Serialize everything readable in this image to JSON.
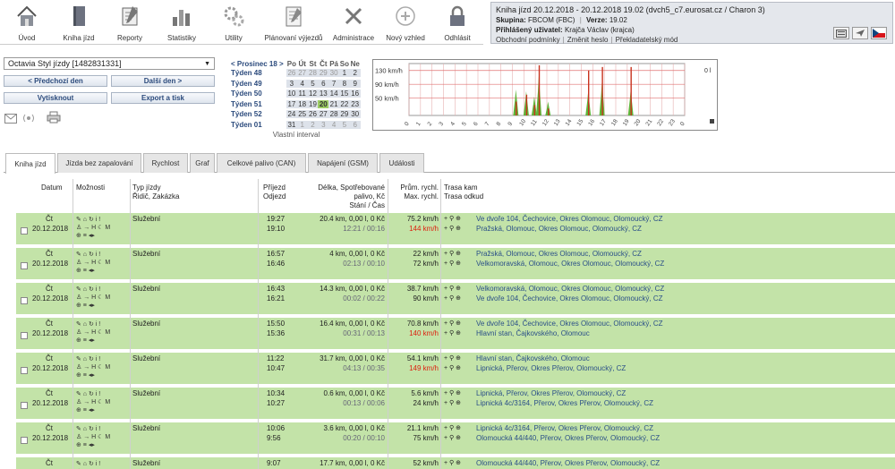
{
  "toolbar": {
    "items": [
      {
        "label": "Úvod",
        "icon": "home-icon"
      },
      {
        "label": "Kniha jízd",
        "icon": "book-icon"
      },
      {
        "label": "Reporty",
        "icon": "report-icon"
      },
      {
        "label": "Statistiky",
        "icon": "statistics-icon"
      },
      {
        "label": "Utility",
        "icon": "gears-icon"
      },
      {
        "label": "Plánovaní výjezdů",
        "icon": "planning-icon"
      },
      {
        "label": "Administrace",
        "icon": "tools-icon"
      },
      {
        "label": "Nový vzhled",
        "icon": "new-look-icon"
      },
      {
        "label": "Odhlásit",
        "icon": "lock-icon"
      }
    ]
  },
  "info": {
    "line1": "Kniha jízd 20.12.2018 - 20.12.2018 19.02 (dvch5_c7.eurosat.cz / Charon 3)",
    "skupina_label": "Skupina:",
    "skupina_value": "FBCOM (FBC)",
    "verze_label": "Verze:",
    "verze_value": "19.02",
    "user_label": "Přihlášený uživatel:",
    "user_value": "Krajča Václav (krajca)",
    "links": [
      "Obchodní podmínky",
      "Změnit heslo",
      "Překladatelský mód"
    ]
  },
  "controls": {
    "vehicle": "Octavia Styl jízdy [1482831331]",
    "prev_day": "< Předchozí den",
    "next_day": "Další den >",
    "print": "Vytisknout",
    "export": "Export a tisk"
  },
  "calendar": {
    "month": "< Prosinec 18 >",
    "daynames": [
      "Po",
      "Út",
      "St",
      "Čt",
      "Pá",
      "So",
      "Ne"
    ],
    "weeks": [
      {
        "label": "Týden 48",
        "days": [
          "26",
          "27",
          "28",
          "29",
          "30",
          "1",
          "2"
        ]
      },
      {
        "label": "Týden 49",
        "days": [
          "3",
          "4",
          "5",
          "6",
          "7",
          "8",
          "9"
        ]
      },
      {
        "label": "Týden 50",
        "days": [
          "10",
          "11",
          "12",
          "13",
          "14",
          "15",
          "16"
        ]
      },
      {
        "label": "Týden 51",
        "days": [
          "17",
          "18",
          "19",
          "20",
          "21",
          "22",
          "23"
        ]
      },
      {
        "label": "Týden 52",
        "days": [
          "24",
          "25",
          "26",
          "27",
          "28",
          "29",
          "30"
        ]
      },
      {
        "label": "Týden 01",
        "days": [
          "31",
          "1",
          "2",
          "3",
          "4",
          "5",
          "6"
        ]
      }
    ],
    "footer": "Vlastní interval"
  },
  "chart_data": {
    "type": "area",
    "yticks": [
      "130 km/h",
      "90 km/h",
      "50 km/h"
    ],
    "ymax": 150,
    "xticks": [
      "0",
      "1",
      "2",
      "3",
      "4",
      "5",
      "6",
      "7",
      "8",
      "9",
      "10",
      "11",
      "12",
      "13",
      "14",
      "15",
      "16",
      "17",
      "18",
      "19",
      "20",
      "21",
      "22",
      "23",
      "0"
    ],
    "corner_label": "0 l",
    "limit_lines": [
      130,
      90,
      50
    ],
    "peaks": [
      {
        "hour": 9.3,
        "speed": 75,
        "red": 40
      },
      {
        "hour": 10.2,
        "speed": 70,
        "red": 60
      },
      {
        "hour": 10.9,
        "speed": 55,
        "red": 30
      },
      {
        "hour": 11.3,
        "speed": 115,
        "red": 145
      },
      {
        "hour": 12.1,
        "speed": 40,
        "red": 20
      },
      {
        "hour": 15.6,
        "speed": 70,
        "red": 130
      },
      {
        "hour": 16.8,
        "speed": 100,
        "red": 140
      },
      {
        "hour": 19.3,
        "speed": 75,
        "red": 140
      }
    ]
  },
  "tabs": [
    "Kniha jízd",
    "Jízda bez zapalování",
    "Rychlost",
    "Graf",
    "Celkové palivo (CAN)",
    "Napájení (GSM)",
    "Události"
  ],
  "table": {
    "headers": {
      "datum": "Datum",
      "moznosti": "Možnosti",
      "typ": "Typ jízdy",
      "typ2": "Řidič, Zakázka",
      "prijezd": "Příjezd",
      "odjezd": "Odjezd",
      "delka1": "Délka, Spotřebované",
      "delka2": "palivo, Kč",
      "delka3": "Stání / Čas",
      "rychl1": "Prům. rychl.",
      "rychl2": "Max. rychl.",
      "trasa1": "Trasa kam",
      "trasa2": "Trasa odkud"
    },
    "icons_line1": "✎ ⌂ ↻ i !",
    "icons_line2": "♙ → H ☾ M",
    "icons_line3": "⊕ ≡ ◂▸",
    "rows": [
      {
        "den": "Čt",
        "datum": "20.12.2018",
        "typ": "Služební",
        "prijezd": "19:27",
        "odjezd": "19:10",
        "delka": "20.4 km, 0,00 l, 0 Kč",
        "cas1": "12:21",
        "cas2": "00:16",
        "prum": "75.2 km/h",
        "max": "144 km/h",
        "max_red": true,
        "kam": "Ve dvoře 104, Čechovice, Okres Olomouc, Olomoucký, CZ",
        "odkud": "Pražská, Olomouc, Okres Olomouc, Olomoucký, CZ"
      },
      {
        "den": "Čt",
        "datum": "20.12.2018",
        "typ": "Služební",
        "prijezd": "16:57",
        "odjezd": "16:46",
        "delka": "4 km, 0,00 l, 0 Kč",
        "cas1": "02:13",
        "cas2": "00:10",
        "prum": "22 km/h",
        "max": "72 km/h",
        "max_red": false,
        "kam": "Pražská, Olomouc, Okres Olomouc, Olomoucký, CZ",
        "odkud": "Velkomoravská, Olomouc, Okres Olomouc, Olomoucký, CZ"
      },
      {
        "den": "Čt",
        "datum": "20.12.2018",
        "typ": "Služební",
        "prijezd": "16:43",
        "odjezd": "16:21",
        "delka": "14.3 km, 0,00 l, 0 Kč",
        "cas1": "00:02",
        "cas2": "00:22",
        "prum": "38.7 km/h",
        "max": "90 km/h",
        "max_red": false,
        "kam": "Velkomoravská, Olomouc, Okres Olomouc, Olomoucký, CZ",
        "odkud": "Ve dvoře 104, Čechovice, Okres Olomouc, Olomoucký, CZ"
      },
      {
        "den": "Čt",
        "datum": "20.12.2018",
        "typ": "Služební",
        "prijezd": "15:50",
        "odjezd": "15:36",
        "delka": "16.4 km, 0,00 l, 0 Kč",
        "cas1": "00:31",
        "cas2": "00:13",
        "prum": "70.8 km/h",
        "max": "140 km/h",
        "max_red": true,
        "kam": "Ve dvoře 104, Čechovice, Okres Olomouc, Olomoucký, CZ",
        "odkud": "Hlavní stan, Čajkovského, Olomouc"
      },
      {
        "den": "Čt",
        "datum": "20.12.2018",
        "typ": "Služební",
        "prijezd": "11:22",
        "odjezd": "10:47",
        "delka": "31.7 km, 0,00 l, 0 Kč",
        "cas1": "04:13",
        "cas2": "00:35",
        "prum": "54.1 km/h",
        "max": "149 km/h",
        "max_red": true,
        "kam": "Hlavní stan, Čajkovského, Olomouc",
        "odkud": "Lipnická, Přerov, Okres Přerov, Olomoucký, CZ"
      },
      {
        "den": "Čt",
        "datum": "20.12.2018",
        "typ": "Služební",
        "prijezd": "10:34",
        "odjezd": "10:27",
        "delka": "0.6 km, 0,00 l, 0 Kč",
        "cas1": "00:13",
        "cas2": "00:06",
        "prum": "5.6 km/h",
        "max": "24 km/h",
        "max_red": false,
        "kam": "Lipnická, Přerov, Okres Přerov, Olomoucký, CZ",
        "odkud": "Lipnická 4c/3164, Přerov, Okres Přerov, Olomoucký, CZ"
      },
      {
        "den": "Čt",
        "datum": "20.12.2018",
        "typ": "Služební",
        "prijezd": "10:06",
        "odjezd": "9:56",
        "delka": "3.6 km, 0,00 l, 0 Kč",
        "cas1": "00:20",
        "cas2": "00:10",
        "prum": "21.1 km/h",
        "max": "75 km/h",
        "max_red": false,
        "kam": "Lipnická 4c/3164, Přerov, Okres Přerov, Olomoucký, CZ",
        "odkud": "Olomoucká 44/440, Přerov, Okres Přerov, Olomoucký, CZ"
      },
      {
        "den": "Čt",
        "datum": "",
        "typ": "Služební",
        "prijezd": "9:07",
        "odjezd": "",
        "delka": "17.7 km, 0,00 l, 0 Kč",
        "cas1": "",
        "cas2": "",
        "prum": "52 km/h",
        "max": "",
        "max_red": false,
        "kam": "Olomoucká 44/440, Přerov, Okres Přerov, Olomoucký, CZ",
        "odkud": ""
      }
    ]
  }
}
